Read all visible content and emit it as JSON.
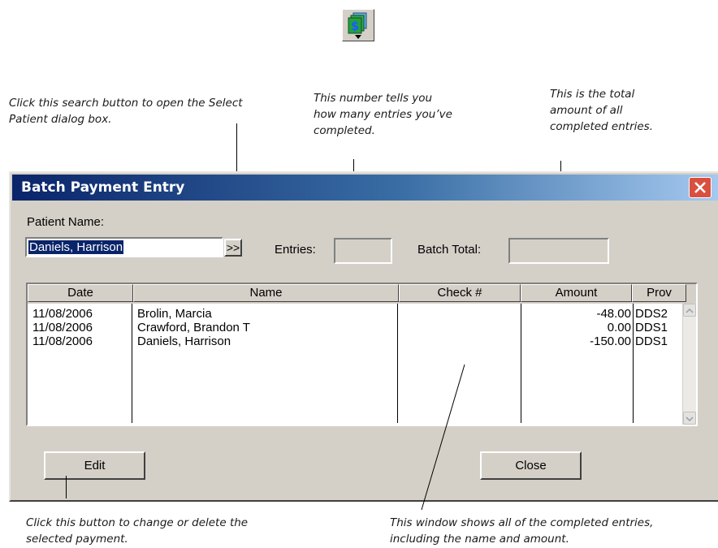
{
  "toolbar_icon": {
    "icon": "batch-payment-money-icon",
    "colors": {
      "bill": "#1f9a3c",
      "symbol": "#1a5cff"
    }
  },
  "callouts": {
    "search_button": [
      "Click this search button to open the Select",
      "Patient dialog box."
    ],
    "entries": [
      "This number tells you",
      "how many entries you’ve",
      "completed."
    ],
    "batch_total": [
      "This is the total",
      "amount of all",
      "completed entries."
    ],
    "edit_button": [
      "Click this button to change or delete the",
      "selected payment."
    ],
    "list_window": [
      "This window shows all of the completed entries,",
      "including the name and amount."
    ]
  },
  "window": {
    "title": "Batch Payment Entry",
    "patient_name_label": "Patient Name:",
    "patient_name_value": "Daniels, Harrison",
    "search_button_label": ">>",
    "entries_label": "Entries:",
    "entries_value": "",
    "batch_total_label": "Batch Total:",
    "batch_total_value": "",
    "columns": [
      "Date",
      "Name",
      "Check #",
      "Amount",
      "Prov"
    ],
    "rows": [
      {
        "date": "11/08/2006",
        "name": "Brolin, Marcia",
        "check": "",
        "amount": "-48.00",
        "prov": "DDS2"
      },
      {
        "date": "11/08/2006",
        "name": "Crawford, Brandon T",
        "check": "",
        "amount": "0.00",
        "prov": "DDS1"
      },
      {
        "date": "11/08/2006",
        "name": "Daniels, Harrison",
        "check": "",
        "amount": "-150.00",
        "prov": "DDS1"
      }
    ],
    "edit_button_label": "Edit",
    "close_button_label": "Close"
  }
}
